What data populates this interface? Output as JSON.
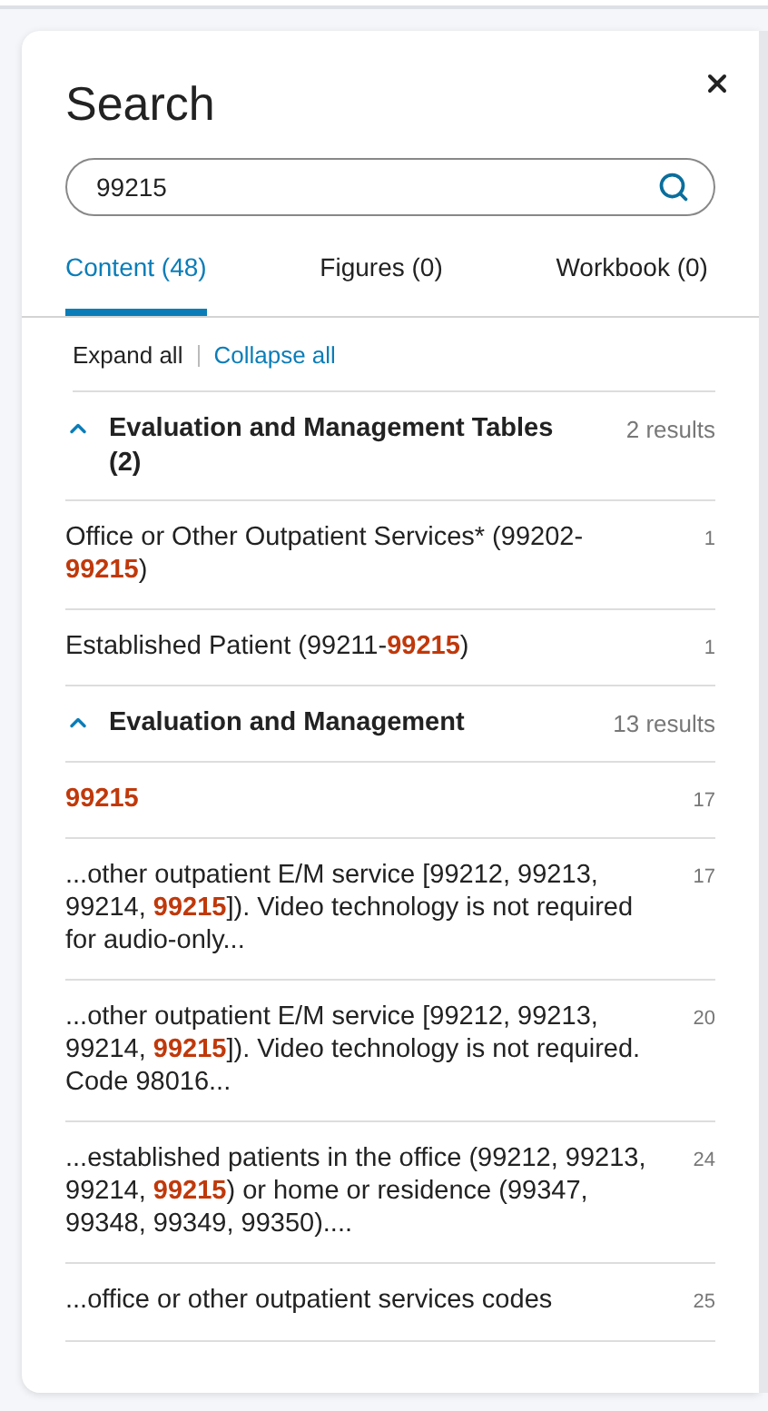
{
  "title": "Search",
  "search": {
    "value": "99215"
  },
  "tabs": [
    {
      "label": "Content (48)",
      "selected": true
    },
    {
      "label": "Figures (0)",
      "selected": false
    },
    {
      "label": "Workbook (0)",
      "selected": false
    }
  ],
  "expand_all": "Expand all",
  "collapse_all": "Collapse all",
  "groups": [
    {
      "title": "Evaluation and Management Tables (2)",
      "count": "2 results",
      "expanded": true,
      "results": [
        {
          "text": "Office or Other Outpatient Services* (99202-**99215**)",
          "page": "1"
        },
        {
          "text": "Established Patient (99211-**99215**)",
          "page": "1"
        }
      ]
    },
    {
      "title": "Evaluation and Management",
      "count": "13 results",
      "expanded": true,
      "results": [
        {
          "text": "**99215**",
          "page": "17"
        },
        {
          "text": "...other outpatient E/M service [99212, 99213, 99214, **99215**]). Video technology is not required for audio-only...",
          "page": "17"
        },
        {
          "text": "...other outpatient E/M service [99212, 99213, 99214, **99215**]). Video technology is not required. Code 98016...",
          "page": "20"
        },
        {
          "text": "...established patients in the office (99212, 99213, 99214, **99215**) or home or residence (99347, 99348, 99349, 99350)....",
          "page": "24"
        },
        {
          "text": "...office or other outpatient services codes",
          "page": "25"
        }
      ]
    }
  ]
}
